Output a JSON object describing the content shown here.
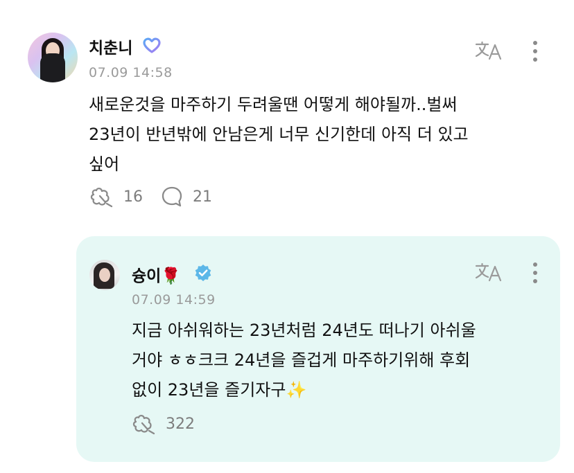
{
  "post": {
    "author": "치춘니",
    "timestamp": "07.09 14:58",
    "lines": [
      "새로운것을 마주하기 두려울땐 어떻게 해야될까..벌써",
      "23년이 반년밖에 안남은게 너무 신기한데 아직 더 있고",
      "싶어"
    ],
    "reaction_count": "16",
    "comment_count": "21",
    "badge_icon": "purple-heart-badge-icon",
    "badge_color": "#8a7cf0"
  },
  "reply": {
    "author": "슝이",
    "author_emoji": "🌹",
    "timestamp": "07.09 14:59",
    "lines": [
      "지금 아쉬워하는 23년처럼 24년도 떠나기 아쉬울",
      "거야 ㅎㅎ크크 24년을 즐겁게 마주하기위해 후회",
      "없이 23년을 즐기자구"
    ],
    "end_emoji": "✨",
    "reaction_count": "322",
    "verified_color": "#5cb7e8",
    "card_color": "#e6f8f5"
  },
  "icons": {
    "translate": "translate-icon",
    "more": "more-options-icon",
    "reaction": "reaction-icon",
    "comment": "comment-bubble-icon"
  }
}
